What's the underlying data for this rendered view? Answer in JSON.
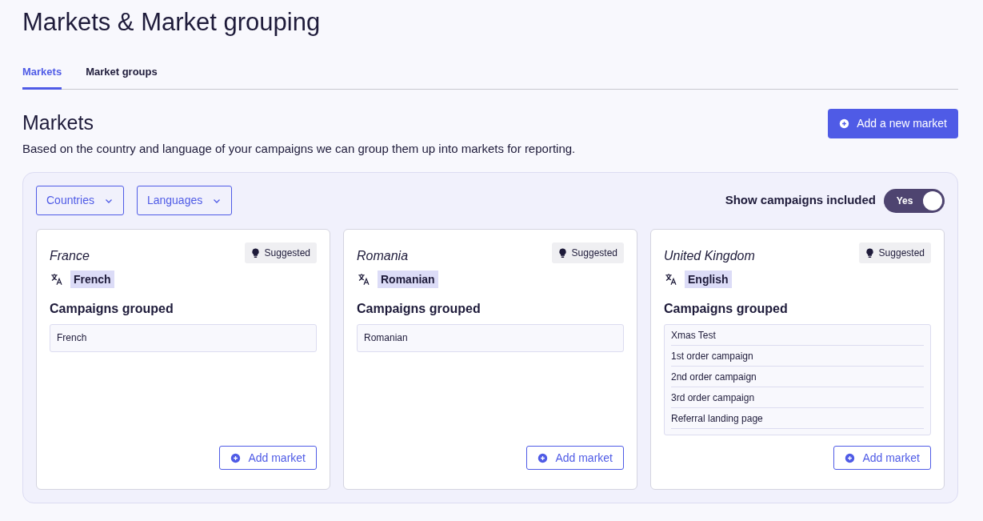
{
  "page_title": "Markets & Market grouping",
  "tabs": [
    {
      "label": "Markets",
      "selected": true
    },
    {
      "label": "Market groups",
      "selected": false
    }
  ],
  "section": {
    "title": "Markets",
    "add_button": "Add a new market",
    "description": "Based on the country and language of your campaigns we can group them up into markets for reporting."
  },
  "filters": [
    "Countries",
    "Languages"
  ],
  "toggle": {
    "label": "Show campaigns included",
    "on": true,
    "value": "Yes"
  },
  "markets": [
    {
      "country": "France",
      "badge": "Suggested",
      "language": "French",
      "campaigns_title": "Campaigns grouped",
      "campaigns": [
        "French"
      ],
      "button": "Add market"
    },
    {
      "country": "Romania",
      "badge": "Suggested",
      "language": "Romanian",
      "campaigns_title": "Campaigns grouped",
      "campaigns": [
        "Romanian"
      ],
      "button": "Add market"
    },
    {
      "country": "United Kingdom",
      "badge": "Suggested",
      "language": "English",
      "campaigns_title": "Campaigns grouped",
      "campaigns": [
        "Xmas Test",
        "1st order campaign",
        "2nd order campaign",
        "3rd order campaign",
        "Referral landing page"
      ],
      "button": "Add market"
    }
  ]
}
